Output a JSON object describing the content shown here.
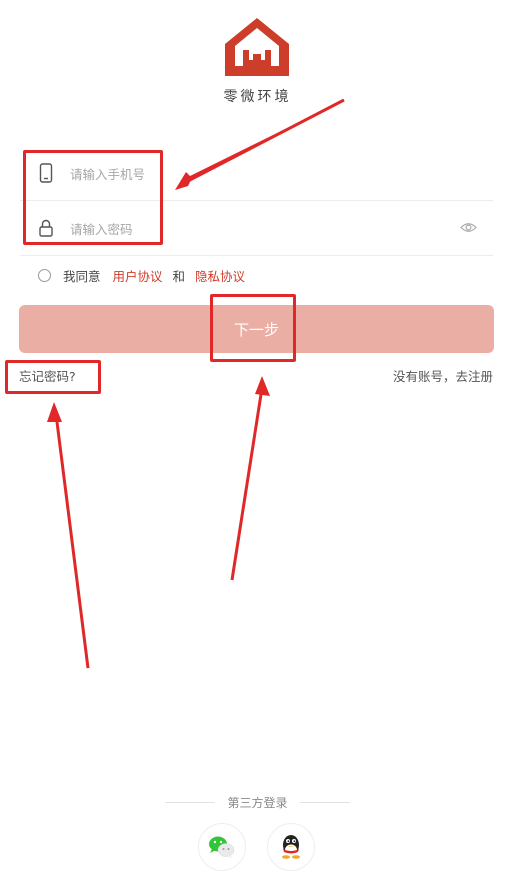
{
  "brand": {
    "name": "零微环境",
    "color": "#cc3d2a"
  },
  "login_form": {
    "phone_placeholder": "请输入手机号",
    "password_placeholder": "请输入密码",
    "phone_icon": "phone-icon",
    "lock_icon": "lock-icon",
    "eye_icon": "eye-icon"
  },
  "agreement": {
    "prefix": "我同意",
    "user_agreement": "用户协议",
    "and": "和",
    "privacy_policy": "隐私协议",
    "link_color": "#cf3d2b"
  },
  "next_button": {
    "label": "下一步",
    "bg_color": "#ebaea4"
  },
  "links": {
    "forgot_password": "忘记密码?",
    "register": "没有账号，去注册"
  },
  "third_party": {
    "title": "第三方登录",
    "providers": [
      "wechat-icon",
      "qq-icon"
    ]
  },
  "annotations": {
    "color": "#e02828"
  }
}
